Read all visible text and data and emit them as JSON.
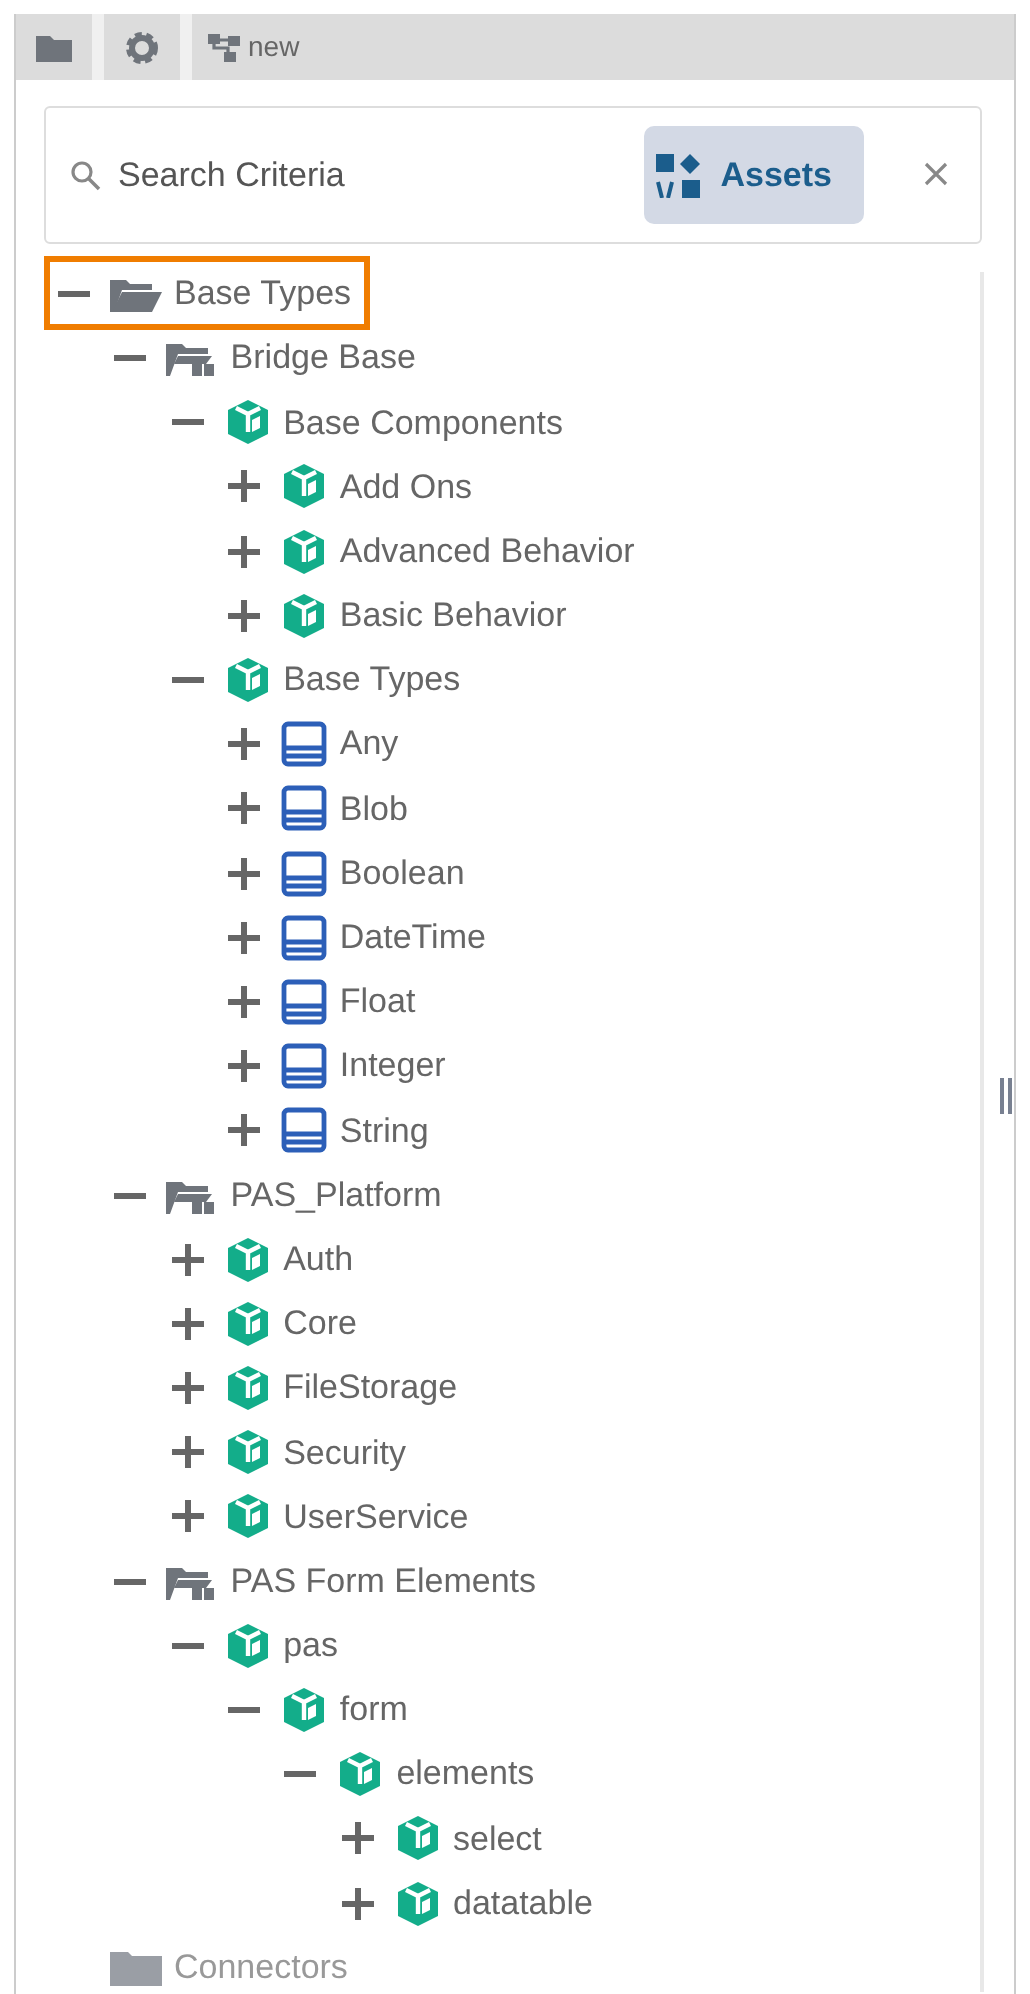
{
  "toolbar": {
    "tabs": [
      {
        "kind": "folder",
        "selected": false
      },
      {
        "kind": "settings",
        "selected": false
      },
      {
        "kind": "diagram",
        "label": "new",
        "selected": true
      }
    ]
  },
  "search": {
    "placeholder": "Search Criteria",
    "filter": {
      "label": "Assets",
      "selected": true
    }
  },
  "tree": [
    {
      "label": "Base Types",
      "kind": "folder",
      "expanded": true,
      "selected": true,
      "children": [
        {
          "label": "Bridge Base",
          "kind": "library",
          "expanded": true,
          "selected": false,
          "children": [
            {
              "label": "Base Components",
              "kind": "module",
              "expanded": true,
              "selected": false,
              "children": [
                {
                  "label": "Add Ons",
                  "kind": "module",
                  "expanded": false,
                  "selected": false
                },
                {
                  "label": "Advanced Behavior",
                  "kind": "module",
                  "expanded": false,
                  "selected": false
                },
                {
                  "label": "Basic Behavior",
                  "kind": "module",
                  "expanded": false,
                  "selected": false
                }
              ]
            },
            {
              "label": "Base Types",
              "kind": "module",
              "expanded": true,
              "selected": false,
              "children": [
                {
                  "label": "Any",
                  "kind": "type",
                  "expanded": false,
                  "selected": false
                },
                {
                  "label": "Blob",
                  "kind": "type",
                  "expanded": false,
                  "selected": false
                },
                {
                  "label": "Boolean",
                  "kind": "type",
                  "expanded": false,
                  "selected": false
                },
                {
                  "label": "DateTime",
                  "kind": "type",
                  "expanded": false,
                  "selected": false
                },
                {
                  "label": "Float",
                  "kind": "type",
                  "expanded": false,
                  "selected": false
                },
                {
                  "label": "Integer",
                  "kind": "type",
                  "expanded": false,
                  "selected": false
                },
                {
                  "label": "String",
                  "kind": "type",
                  "expanded": false,
                  "selected": false
                }
              ]
            }
          ]
        },
        {
          "label": "PAS_Platform",
          "kind": "library",
          "expanded": true,
          "selected": false,
          "children": [
            {
              "label": "Auth",
              "kind": "module",
              "expanded": false,
              "selected": false
            },
            {
              "label": "Core",
              "kind": "module",
              "expanded": false,
              "selected": false
            },
            {
              "label": "FileStorage",
              "kind": "module",
              "expanded": false,
              "selected": false
            },
            {
              "label": "Security",
              "kind": "module",
              "expanded": false,
              "selected": false
            },
            {
              "label": "UserService",
              "kind": "module",
              "expanded": false,
              "selected": false
            }
          ]
        },
        {
          "label": "PAS Form Elements",
          "kind": "library",
          "expanded": true,
          "selected": false,
          "children": [
            {
              "label": "pas",
              "kind": "module",
              "expanded": true,
              "selected": false,
              "children": [
                {
                  "label": "form",
                  "kind": "module",
                  "expanded": true,
                  "selected": false,
                  "children": [
                    {
                      "label": "elements",
                      "kind": "module",
                      "expanded": true,
                      "selected": false,
                      "children": [
                        {
                          "label": "select",
                          "kind": "module",
                          "expanded": false,
                          "selected": false
                        },
                        {
                          "label": "datatable",
                          "kind": "module",
                          "expanded": false,
                          "selected": false
                        }
                      ]
                    }
                  ]
                }
              ]
            }
          ]
        }
      ]
    },
    {
      "label": "Connectors",
      "kind": "closed-folder",
      "selected": false
    }
  ]
}
